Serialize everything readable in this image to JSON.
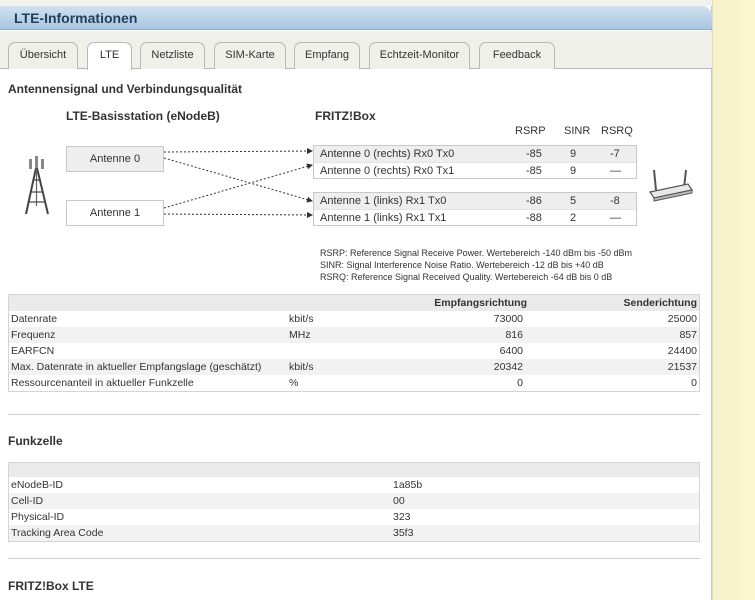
{
  "window": {
    "title": "LTE-Informationen"
  },
  "tabs": [
    {
      "label": "Übersicht",
      "active": false
    },
    {
      "label": "LTE",
      "active": true
    },
    {
      "label": "Netzliste",
      "active": false
    },
    {
      "label": "SIM-Karte",
      "active": false
    },
    {
      "label": "Empfang",
      "active": false
    },
    {
      "label": "Echtzeit-Monitor",
      "active": false
    },
    {
      "label": "Feedback",
      "active": false
    }
  ],
  "signal": {
    "heading": "Antennensignal und Verbindungsqualität",
    "basestation_label": "LTE-Basisstation (eNodeB)",
    "fritzbox_label": "FRITZ!Box",
    "columns": [
      "RSRP",
      "SINR",
      "RSRQ"
    ],
    "antennas": [
      "Antenne 0",
      "Antenne 1"
    ],
    "rx_rows": [
      {
        "label": "Antenne 0 (rechts) Rx0 Tx0",
        "rsrp": "-85",
        "sinr": "9",
        "rsrq": "-7"
      },
      {
        "label": "Antenne 0 (rechts) Rx0 Tx1",
        "rsrp": "-85",
        "sinr": "9",
        "rsrq": "—"
      },
      {
        "label": "Antenne 1 (links) Rx1 Tx0",
        "rsrp": "-86",
        "sinr": "5",
        "rsrq": "-8"
      },
      {
        "label": "Antenne 1 (links) Rx1 Tx1",
        "rsrp": "-88",
        "sinr": "2",
        "rsrq": "—"
      }
    ],
    "legend": [
      "RSRP: Reference Signal Receive Power. Wertebereich -140 dBm bis -50 dBm",
      "SINR: Signal Interference Noise Ratio. Wertebereich -12 dB bis +40 dB",
      "RSRQ: Reference Signal Received Quality. Wertebereich -64 dB bis 0 dB"
    ]
  },
  "rates": {
    "headers": {
      "rx": "Empfangsrichtung",
      "tx": "Senderichtung"
    },
    "rows": [
      {
        "label": "Datenrate",
        "unit": "kbit/s",
        "rx": "73000",
        "tx": "25000"
      },
      {
        "label": "Frequenz",
        "unit": "MHz",
        "rx": "816",
        "tx": "857"
      },
      {
        "label": "EARFCN",
        "unit": "",
        "rx": "6400",
        "tx": "24400"
      },
      {
        "label": "Max. Datenrate in aktueller Empfangslage (geschätzt)",
        "unit": "kbit/s",
        "rx": "20342",
        "tx": "21537"
      },
      {
        "label": "Ressourcenanteil in aktueller Funkzelle",
        "unit": "%",
        "rx": "0",
        "tx": "0"
      }
    ]
  },
  "cell": {
    "heading": "Funkzelle",
    "rows": [
      {
        "label": "eNodeB-ID",
        "value": "1a85b"
      },
      {
        "label": "Cell-ID",
        "value": "00"
      },
      {
        "label": "Physical-ID",
        "value": "323"
      },
      {
        "label": "Tracking Area Code",
        "value": "35f3"
      }
    ]
  },
  "fritzbox_section": {
    "heading": "FRITZ!Box LTE"
  }
}
